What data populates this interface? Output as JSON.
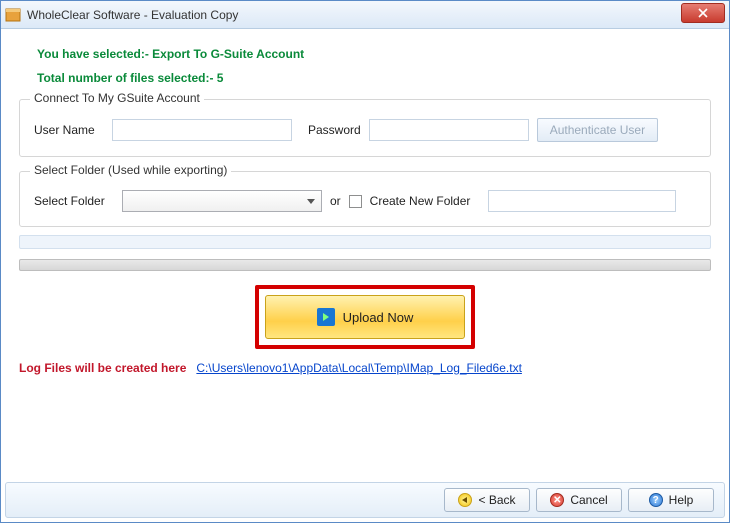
{
  "window": {
    "title": "WholeClear Software - Evaluation Copy"
  },
  "info": {
    "selected": "You have selected:- Export To G-Suite Account",
    "count": "Total number of files selected:- 5"
  },
  "gsuite": {
    "legend": "Connect To My GSuite Account",
    "username_label": "User Name",
    "username_value": "",
    "password_label": "Password",
    "password_value": "",
    "auth_label": "Authenticate User"
  },
  "folder": {
    "legend": "Select Folder (Used while exporting)",
    "select_label": "Select Folder",
    "select_value": "",
    "or_label": "or",
    "create_label": "Create New Folder",
    "new_folder_value": ""
  },
  "upload": {
    "label": "Upload Now"
  },
  "log": {
    "label": "Log Files will be created here",
    "path": "C:\\Users\\lenovo1\\AppData\\Local\\Temp\\IMap_Log_Filed6e.txt"
  },
  "footer": {
    "back": "< Back",
    "cancel": "Cancel",
    "help": "Help"
  }
}
